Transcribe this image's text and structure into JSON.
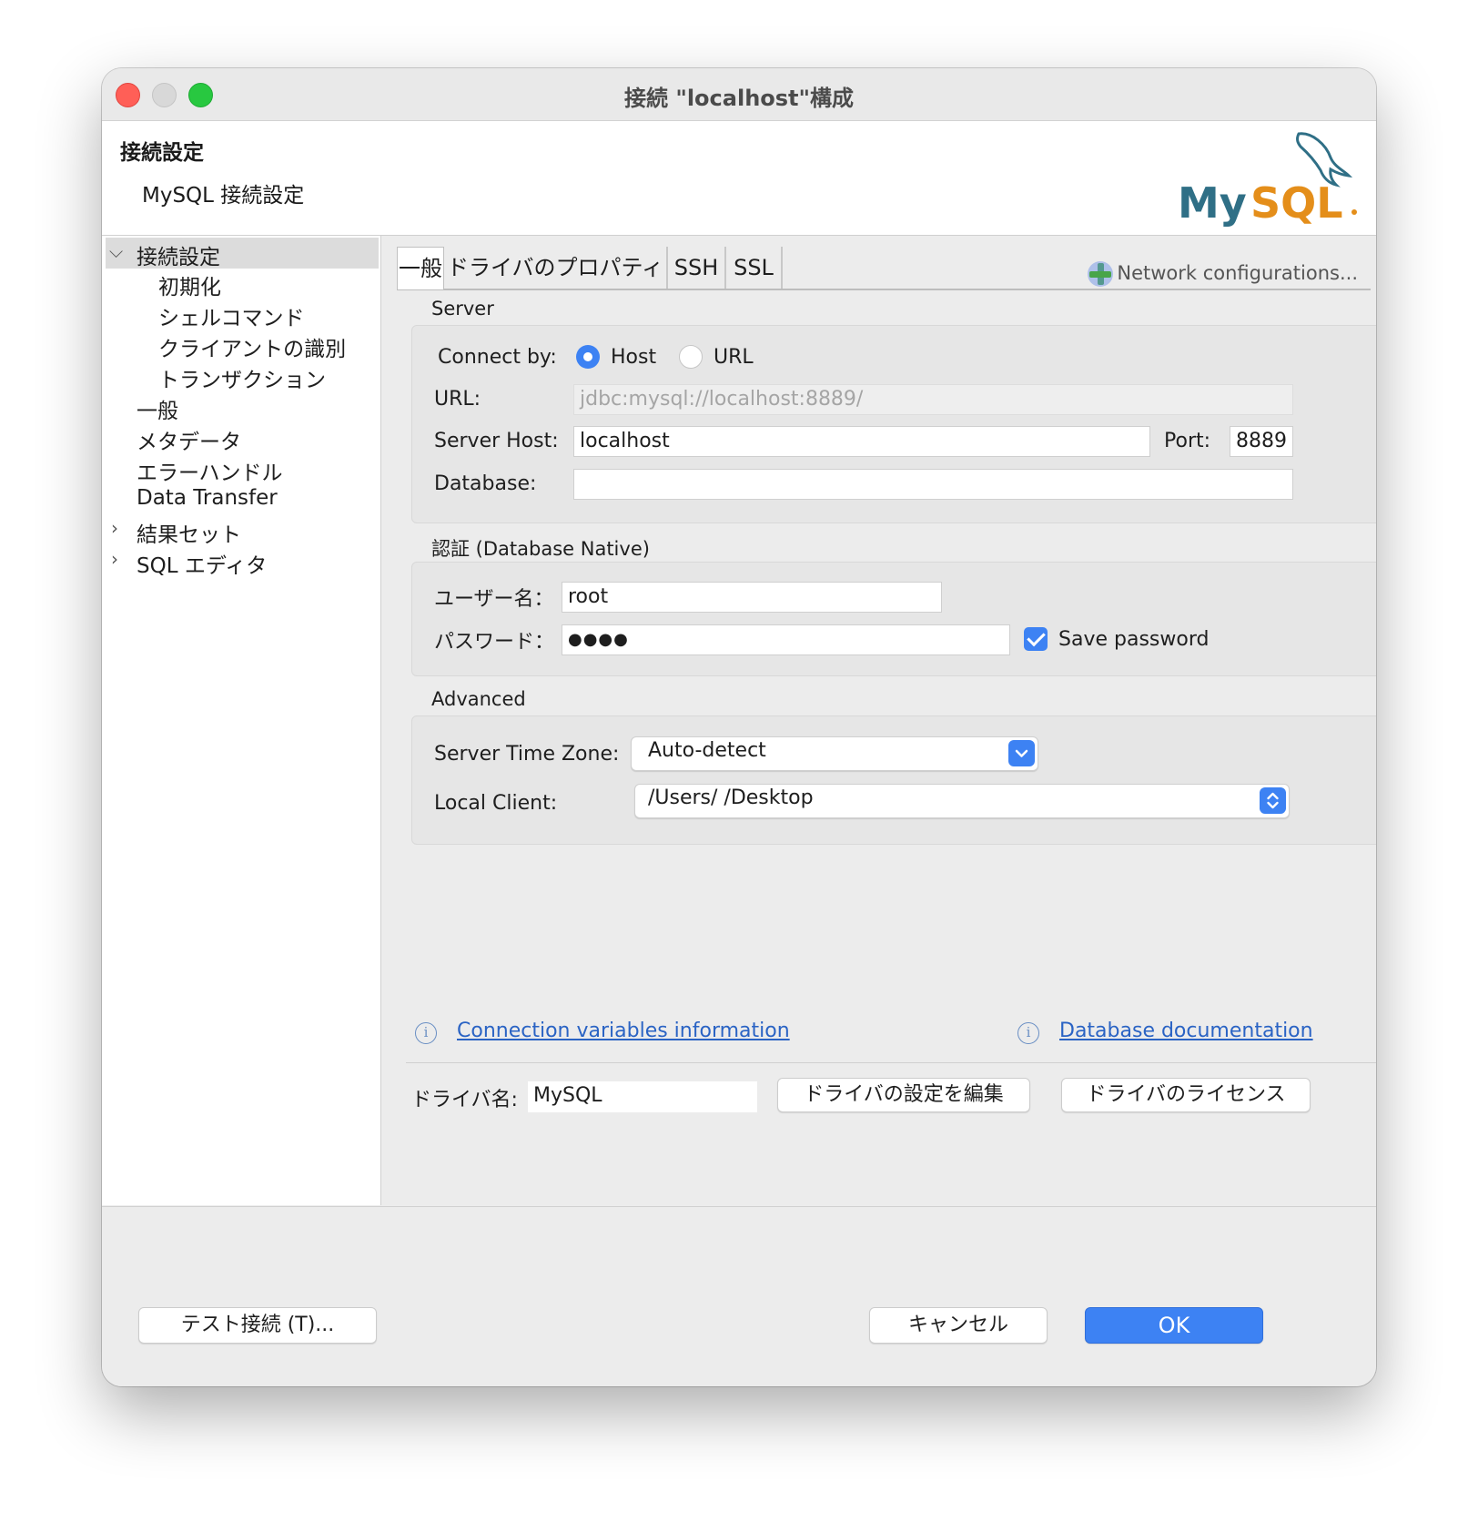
{
  "window": {
    "title": "接続 \"localhost\"構成"
  },
  "header": {
    "title": "接続設定",
    "subtitle": "MySQL 接続設定",
    "logo_icon": "mysql-dolphin-logo"
  },
  "sidebar": {
    "items": [
      {
        "label": "接続設定",
        "expanded": true,
        "selected": true
      },
      {
        "label": "初期化"
      },
      {
        "label": "シェルコマンド"
      },
      {
        "label": "クライアントの識別"
      },
      {
        "label": "トランザクション"
      },
      {
        "label": "一般"
      },
      {
        "label": "メタデータ"
      },
      {
        "label": "エラーハンドル"
      },
      {
        "label": "Data Transfer"
      },
      {
        "label": "結果セット",
        "collapsed": true
      },
      {
        "label": "SQL エディタ",
        "collapsed": true
      }
    ]
  },
  "tabs": [
    {
      "label": "一般",
      "active": true
    },
    {
      "label": "ドライバのプロパティ"
    },
    {
      "label": "SSH"
    },
    {
      "label": "SSL"
    }
  ],
  "network_config_label": "Network configurations...",
  "server": {
    "section_label": "Server",
    "connect_by_label": "Connect by:",
    "connect_by_options": [
      "Host",
      "URL"
    ],
    "connect_by_selected": "Host",
    "url_label": "URL:",
    "url_value": "jdbc:mysql://localhost:8889/",
    "host_label": "Server Host:",
    "host_value": "localhost",
    "port_label": "Port:",
    "port_value": "8889",
    "database_label": "Database:",
    "database_value": ""
  },
  "auth": {
    "section_label": "認証 (Database Native)",
    "user_label": "ユーザー名：",
    "user_value": "root",
    "password_label": "パスワード：",
    "password_value": "●●●●",
    "save_password_label": "Save password",
    "save_password_checked": true
  },
  "advanced": {
    "section_label": "Advanced",
    "timezone_label": "Server Time Zone:",
    "timezone_value": "Auto-detect",
    "local_client_label": "Local Client:",
    "local_client_value": "/Users/        /Desktop"
  },
  "links": {
    "connection_variables": "Connection variables information",
    "database_documentation": "Database documentation"
  },
  "driver": {
    "name_label": "ドライバ名:",
    "name_value": "MySQL",
    "edit_button": "ドライバの設定を編集",
    "license_button": "ドライバのライセンス"
  },
  "footer": {
    "test_button": "テスト接続 (T)...",
    "cancel_button": "キャンセル",
    "ok_button": "OK"
  },
  "colors": {
    "accent": "#3d82f3",
    "link": "#2a63c4"
  }
}
